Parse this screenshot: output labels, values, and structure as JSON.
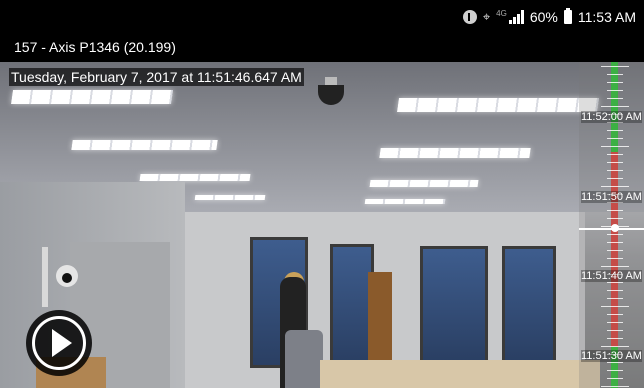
{
  "status_bar": {
    "battery": "60%",
    "time": "11:53 AM",
    "network_type": "4G"
  },
  "camera": {
    "title": "157 - Axis P1346 (20.199)",
    "timestamp": "Tuesday, February 7, 2017 at 11:51:46.647 AM"
  },
  "timeline": {
    "labels": [
      "11:52:00 AM",
      "11:51:50 AM",
      "11:51:40 AM",
      "11:51:30 AM"
    ]
  },
  "colors": {
    "recording_green": "#3cb043",
    "recording_red": "#c54c48"
  },
  "icons": [
    "bluetooth-icon",
    "wifi-icon",
    "signal-icon",
    "battery-icon",
    "play-icon"
  ]
}
